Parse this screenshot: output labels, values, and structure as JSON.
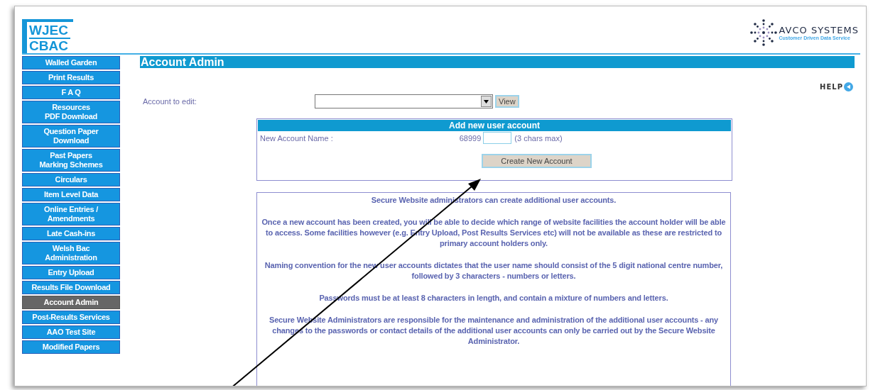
{
  "header": {
    "logo_lines": [
      "WJEC",
      "CBAC"
    ],
    "brand": "AVCO SYSTEMS",
    "tagline": "Customer Driven Data Service"
  },
  "sidebar": {
    "items": [
      {
        "label": "Walled Garden",
        "selected": false
      },
      {
        "label": "Print Results",
        "selected": false
      },
      {
        "label": "F A Q",
        "selected": false
      },
      {
        "label": "Resources\nPDF Download",
        "selected": false
      },
      {
        "label": "Question Paper\nDownload",
        "selected": false
      },
      {
        "label": "Past Papers\nMarking Schemes",
        "selected": false
      },
      {
        "label": "Circulars",
        "selected": false
      },
      {
        "label": "Item Level Data",
        "selected": false
      },
      {
        "label": "Online Entries /\nAmendments",
        "selected": false
      },
      {
        "label": "Late Cash-ins",
        "selected": false
      },
      {
        "label": "Welsh Bac\nAdministration",
        "selected": false
      },
      {
        "label": "Entry Upload",
        "selected": false
      },
      {
        "label": "Results File Download",
        "selected": false
      },
      {
        "label": "Account Admin",
        "selected": true
      },
      {
        "label": "Post-Results Services",
        "selected": false
      },
      {
        "label": "AAO Test Site",
        "selected": false
      },
      {
        "label": "Modified Papers",
        "selected": false
      }
    ]
  },
  "page_title": "Account Admin",
  "help": "HELP",
  "account_to_edit": {
    "label": "Account to edit:",
    "button": "View"
  },
  "add_account": {
    "title": "Add new user account",
    "name_label": "New Account Name :",
    "prefix": "68999",
    "hint": "(3 chars max)",
    "button": "Create New Account"
  },
  "info_paragraphs": [
    "Secure Website administrators can create additional user accounts.",
    "Once a new account has been created, you will be able to decide which range of website facilities the account holder will be able to access. Some facilities however (e.g. Entry Upload, Post Results Services etc) will not be available as these are restricted to primary account holders only.",
    "Naming convention for the new user accounts dictates that the user name should consist of the 5 digit national centre number, followed by 3 characters - numbers or letters.",
    "Passwords must be at least 8 characters in length, and contain a mixture of numbers and letters.",
    "Secure Website Administrators are responsible for the maintenance and administration of the additional user accounts - any changes to the passwords or contact details of the additional user accounts can only be carried out by the Secure Website Administrator."
  ]
}
